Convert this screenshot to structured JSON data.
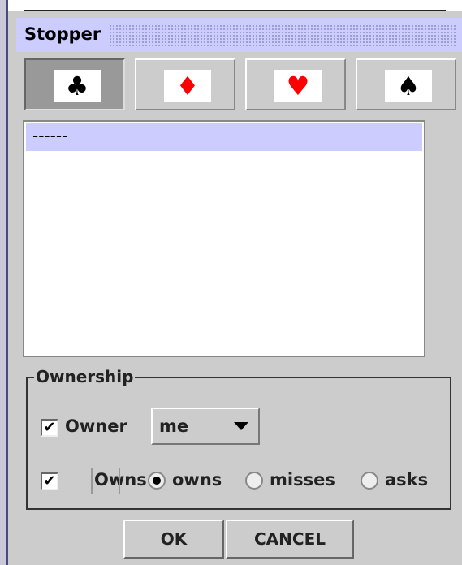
{
  "window": {
    "title": "Stopper"
  },
  "suits": [
    {
      "name": "clubs",
      "glyph": "♣",
      "color": "#000000",
      "selected": true
    },
    {
      "name": "diamonds",
      "glyph": "♦",
      "color": "#ff0000",
      "selected": false
    },
    {
      "name": "hearts",
      "glyph": "♥",
      "color": "#ff0000",
      "selected": false
    },
    {
      "name": "spades",
      "glyph": "♠",
      "color": "#000000",
      "selected": false
    }
  ],
  "list": {
    "items": [
      "------"
    ]
  },
  "ownership": {
    "title": "Ownership",
    "owner_label": "Owner",
    "owner_checked": "✔",
    "owner_value": "me",
    "owns_label": "Owns",
    "owns_checked": "✔",
    "options": [
      "owns",
      "misses",
      "asks"
    ],
    "selected_option": "owns"
  },
  "buttons": {
    "ok": "OK",
    "cancel": "CANCEL"
  }
}
